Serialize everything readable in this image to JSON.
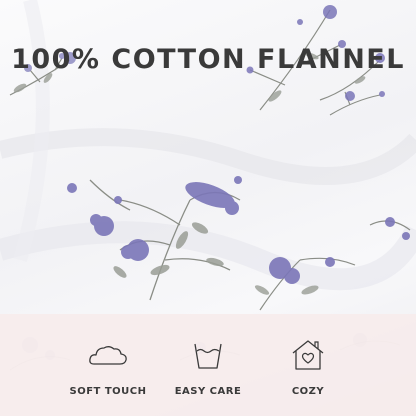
{
  "headline": "100% COTTON FLANNEL",
  "features": [
    {
      "icon": "cloud-icon",
      "label": "SOFT TOUCH"
    },
    {
      "icon": "wash-tub-icon",
      "label": "EASY CARE"
    },
    {
      "icon": "house-heart-icon",
      "label": "COZY"
    }
  ],
  "colors": {
    "headline_text": "#3a3a3a",
    "flower_purple": "#7b76b8",
    "leaf_gray": "#8a8d86",
    "band_background": "#f6ecec"
  }
}
